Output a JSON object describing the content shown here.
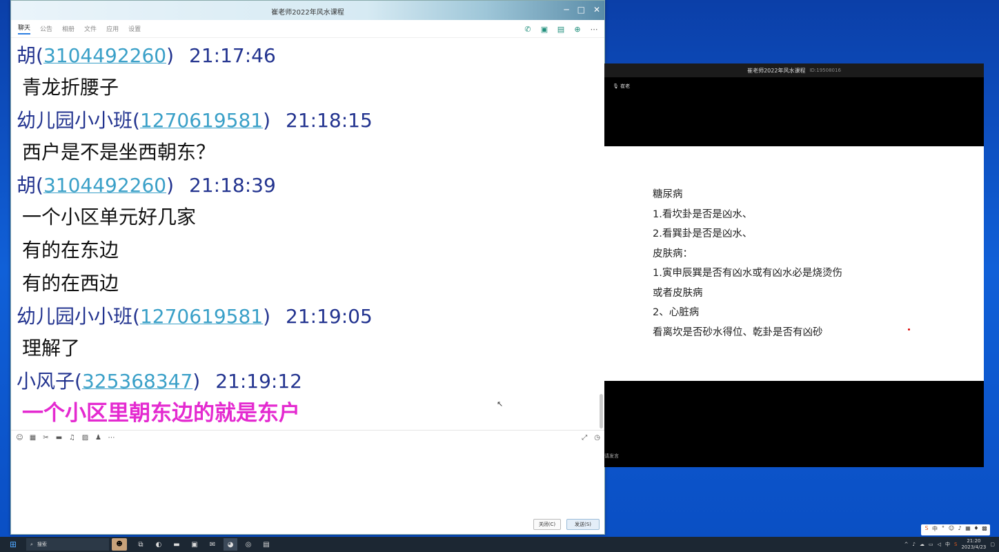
{
  "chat_window": {
    "title": "崔老师2022年风水课程",
    "tabs": [
      "聊天",
      "公告",
      "相册",
      "文件",
      "应用",
      "设置"
    ],
    "messages": [
      {
        "type": "head",
        "name": "胡(",
        "qq": "3104492260",
        "close": ")",
        "time": "21:17:46"
      },
      {
        "type": "body",
        "text": "青龙折腰子"
      },
      {
        "type": "head",
        "name": "幼儿园小小班(",
        "qq": "1270619581",
        "close": ")",
        "time": "21:18:15"
      },
      {
        "type": "body",
        "text": "西户是不是坐西朝东？"
      },
      {
        "type": "head",
        "name": "胡(",
        "qq": "3104492260",
        "close": ")",
        "time": "21:18:39"
      },
      {
        "type": "body",
        "text": "一个小区单元好几家"
      },
      {
        "type": "body",
        "text": "有的在东边"
      },
      {
        "type": "body",
        "text": "有的在西边"
      },
      {
        "type": "head",
        "name": "幼儿园小小班(",
        "qq": "1270619581",
        "close": ")",
        "time": "21:19:05"
      },
      {
        "type": "body",
        "text": "理解了"
      },
      {
        "type": "head",
        "name": "小风子(",
        "qq": "325368347",
        "close": ")",
        "time": "21:19:12"
      },
      {
        "type": "body",
        "text": "一个小区里朝东边的就是东户",
        "highlight": "#e42ad0"
      }
    ],
    "close_button": "关闭(C)",
    "send_button": "发送(S)"
  },
  "meeting_window": {
    "title": "崔老师2022年风水课程",
    "meeting_id": "ID:19508016",
    "speaker": "崔老",
    "bottom_hint": "请发言",
    "slide_lines": [
      "糖尿病",
      "1.看坎卦是否是凶水、",
      "2.看巽卦是否是凶水、",
      "皮肤病：",
      "1.寅申辰巽是否有凶水或有凶水必是烧烫伤",
      "或者皮肤病",
      "2、心脏病",
      "看离坎是否砂水得位、乾卦是否有凶砂"
    ]
  },
  "taskbar": {
    "search_label": "搜索",
    "tray_lang": "中",
    "time": "21:20",
    "date": "2023/4/23"
  },
  "colors": {
    "accent": "#2a7de1",
    "name": "#22338f",
    "qq": "#3aa0c8",
    "highlight": "#e42ad0"
  }
}
